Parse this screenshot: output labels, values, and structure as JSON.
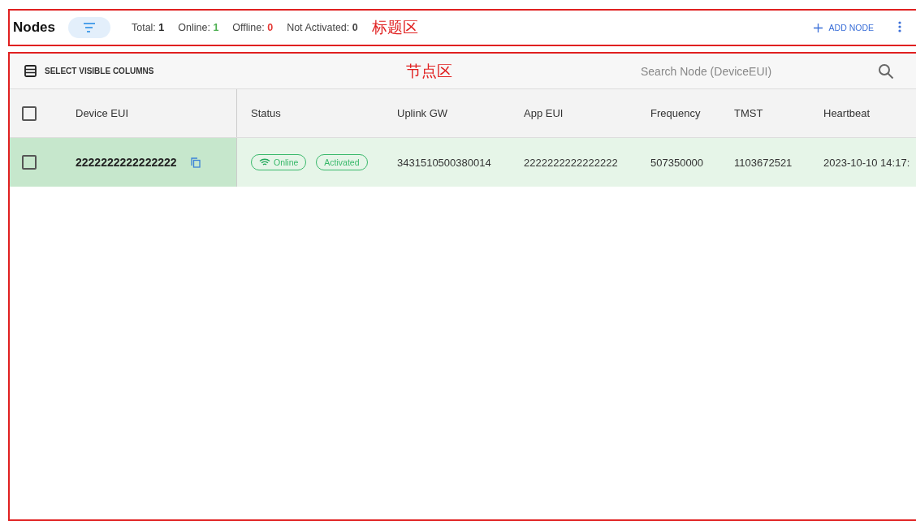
{
  "header": {
    "title": "Nodes",
    "stats": [
      {
        "label": "Total:",
        "value": "1",
        "kind": "total"
      },
      {
        "label": "Online:",
        "value": "1",
        "kind": "online"
      },
      {
        "label": "Offline:",
        "value": "0",
        "kind": "offline"
      },
      {
        "label": "Not Activated:",
        "value": "0",
        "kind": "plain"
      }
    ],
    "annotation": "标题区",
    "add_button": "ADD NODE"
  },
  "toolbar": {
    "columns_button": "SELECT VISIBLE COLUMNS",
    "annotation": "节点区",
    "search": {
      "placeholder": "Search Node (DeviceEUI)"
    }
  },
  "table": {
    "header_checked": false,
    "columns": [
      "Device EUI",
      "Status",
      "Uplink GW",
      "App EUI",
      "Frequency",
      "TMST",
      "Heartbeat"
    ],
    "rows": [
      {
        "selected": false,
        "device_eui": "2222222222222222",
        "online": "Online",
        "activated": "Activated",
        "uplink_gw": "3431510500380014",
        "app_eui": "2222222222222222",
        "frequency": "507350000",
        "tmst": "1103672521",
        "heartbeat": "2023-10-10 14:17:"
      }
    ]
  }
}
